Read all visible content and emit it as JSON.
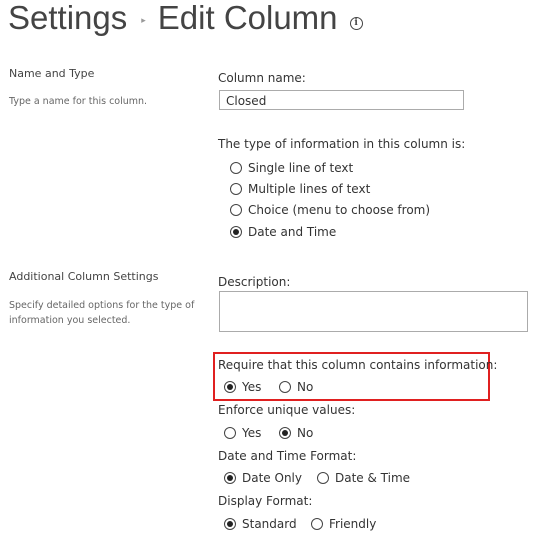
{
  "header": {
    "crumb_parent": "Settings",
    "crumb_separator": "▸",
    "crumb_current": "Edit Column",
    "info_icon": "info-icon"
  },
  "name_type_section": {
    "title": "Name and Type",
    "description": "Type a name for this column.",
    "column_name_label": "Column name:",
    "column_name_value": "Closed",
    "type_label": "The type of information in this column is:",
    "type_options": [
      {
        "label": "Single line of text",
        "selected": false
      },
      {
        "label": "Multiple lines of text",
        "selected": false
      },
      {
        "label": "Choice (menu to choose from)",
        "selected": false
      },
      {
        "label": "Date and Time",
        "selected": true
      }
    ]
  },
  "additional_section": {
    "title": "Additional Column Settings",
    "description": "Specify detailed options for the type of information you selected.",
    "description_label": "Description:",
    "description_value": "",
    "require": {
      "label": "Require that this column contains information:",
      "options": [
        {
          "label": "Yes",
          "selected": true
        },
        {
          "label": "No",
          "selected": false
        }
      ]
    },
    "unique": {
      "label": "Enforce unique values:",
      "options": [
        {
          "label": "Yes",
          "selected": false
        },
        {
          "label": "No",
          "selected": true
        }
      ]
    },
    "date_format": {
      "label": "Date and Time Format:",
      "options": [
        {
          "label": "Date Only",
          "selected": true
        },
        {
          "label": "Date & Time",
          "selected": false
        }
      ]
    },
    "display_format": {
      "label": "Display Format:",
      "options": [
        {
          "label": "Standard",
          "selected": true
        },
        {
          "label": "Friendly",
          "selected": false
        }
      ]
    }
  },
  "colors": {
    "highlight": "#e02020"
  }
}
